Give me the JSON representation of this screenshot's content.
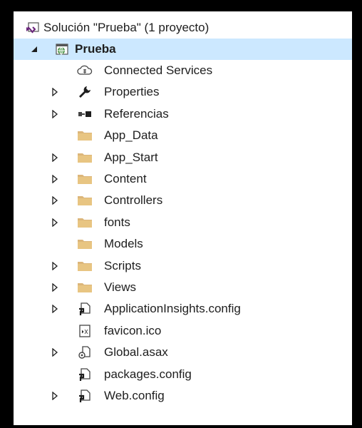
{
  "solution": {
    "label": "Solución \"Prueba\"  (1 proyecto)",
    "icon": "solution-icon"
  },
  "project": {
    "label": "Prueba",
    "icon": "web-project-icon",
    "expanded": true,
    "selected": true
  },
  "items": [
    {
      "label": "Connected Services",
      "icon": "connected-services-icon",
      "expandable": false
    },
    {
      "label": "Properties",
      "icon": "wrench-icon",
      "expandable": true
    },
    {
      "label": "Referencias",
      "icon": "references-icon",
      "expandable": true
    },
    {
      "label": "App_Data",
      "icon": "folder-icon",
      "expandable": false
    },
    {
      "label": "App_Start",
      "icon": "folder-icon",
      "expandable": true
    },
    {
      "label": "Content",
      "icon": "folder-icon",
      "expandable": true
    },
    {
      "label": "Controllers",
      "icon": "folder-icon",
      "expandable": true
    },
    {
      "label": "fonts",
      "icon": "folder-icon",
      "expandable": true
    },
    {
      "label": "Models",
      "icon": "folder-icon",
      "expandable": false
    },
    {
      "label": "Scripts",
      "icon": "folder-icon",
      "expandable": true
    },
    {
      "label": "Views",
      "icon": "folder-icon",
      "expandable": true
    },
    {
      "label": "ApplicationInsights.config",
      "icon": "config-file-icon",
      "expandable": true
    },
    {
      "label": "favicon.ico",
      "icon": "ico-file-icon",
      "expandable": false
    },
    {
      "label": "Global.asax",
      "icon": "asax-file-icon",
      "expandable": true
    },
    {
      "label": "packages.config",
      "icon": "config-file-icon",
      "expandable": false
    },
    {
      "label": "Web.config",
      "icon": "config-file-icon",
      "expandable": true
    }
  ],
  "colors": {
    "selection": "#cce8ff",
    "folder": "#dcb67a",
    "text": "#1e1e1e",
    "frame": "#000000"
  }
}
